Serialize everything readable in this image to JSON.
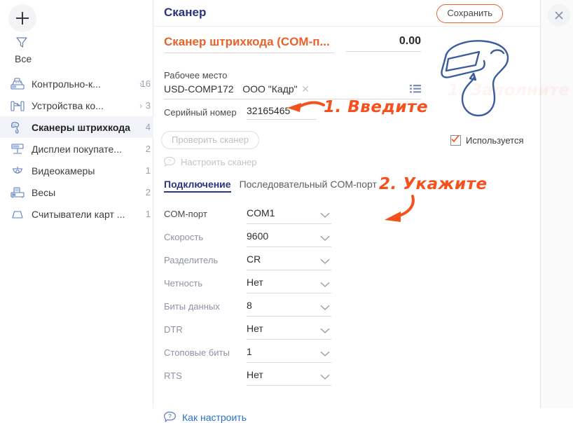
{
  "sidebar": {
    "add_button_label": "+",
    "filter_icon": "funnel-icon",
    "all_label": "Все",
    "items": [
      {
        "label": "Контрольно-к...",
        "count": "16",
        "icon": "cash-register-icon",
        "has_chevron": true,
        "active": false
      },
      {
        "label": "Устройства ко...",
        "count": "3",
        "icon": "turnstile-icon",
        "has_chevron": true,
        "active": false
      },
      {
        "label": "Сканеры штрихкода",
        "count": "4",
        "icon": "barcode-scanner-icon",
        "has_chevron": false,
        "active": true
      },
      {
        "label": "Дисплеи покупате...",
        "count": "2",
        "icon": "customer-display-icon",
        "has_chevron": false,
        "active": false
      },
      {
        "label": "Видеокамеры",
        "count": "1",
        "icon": "video-camera-icon",
        "has_chevron": false,
        "active": false
      },
      {
        "label": "Весы",
        "count": "2",
        "icon": "scales-icon",
        "has_chevron": false,
        "active": false
      },
      {
        "label": "Считыватели карт ...",
        "count": "1",
        "icon": "card-reader-icon",
        "has_chevron": false,
        "active": false
      }
    ]
  },
  "panel": {
    "title": "Сканер",
    "save_label": "Сохранить",
    "close_icon": "close-icon"
  },
  "form": {
    "name_value": "Сканер штрихкода (COM-п...",
    "price_value": "0.00",
    "workplace_label": "Рабочее место",
    "workplace_value_1": "USD-COMP172",
    "workplace_value_2": "ООО \"Кадр\"",
    "workplace_clear_icon": "clear-x-icon",
    "workplace_list_icon": "list-picker-icon",
    "serial_label": "Серийный номер",
    "serial_value": "32165465",
    "check_scanner_label": "Проверить сканер",
    "setup_scanner_label": "Настроить сканер",
    "setup_scanner_icon": "question-bubble-icon",
    "tab_label": "Подключение",
    "tab_value": "Последовательный COM-порт",
    "how_to_label": "Как настроить",
    "how_to_icon": "question-bubble-icon",
    "used_label": "Используется",
    "used_checked": true,
    "scanner_illustration": "barcode-scanner-illustration",
    "rows": [
      {
        "label": "COM-порт",
        "value": "COM1"
      },
      {
        "label": "Скорость",
        "value": "9600"
      },
      {
        "label": "Разделитель",
        "value": "CR"
      },
      {
        "label": "Четность",
        "value": "Нет"
      },
      {
        "label": "Биты данных",
        "value": "8"
      },
      {
        "label": "DTR",
        "value": "Нет"
      },
      {
        "label": "Стоповые биты",
        "value": "1"
      },
      {
        "label": "RTS",
        "value": "Нет"
      }
    ]
  },
  "annotations": {
    "step1": "1. Введите",
    "step2": "2. Укажите",
    "ghost": "1. Заполните"
  },
  "colors": {
    "accent_orange": "#e8622a",
    "annotation_orange": "#f4511e",
    "title_blue": "#2a3580",
    "link_blue": "#2a6fc9",
    "icon_blue": "#5b7bbd",
    "active_row_bg": "#f2f3f8"
  }
}
